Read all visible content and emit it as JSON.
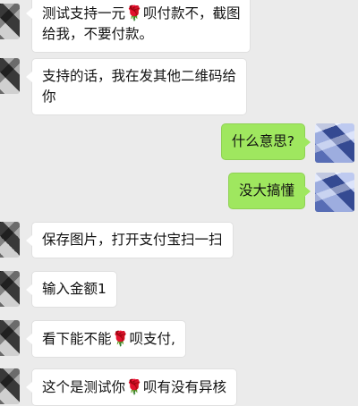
{
  "messages": [
    {
      "side": "left",
      "line1_a": "测试支持一元",
      "line1_b": "呗付款不，截图",
      "line2": "给我，不要付款。",
      "emoji": "rose-icon"
    },
    {
      "side": "left",
      "line1": "支持的话，我在发其他二维码给",
      "line2": "你"
    },
    {
      "side": "right",
      "text": "什么意思?"
    },
    {
      "side": "right",
      "text": "没大搞懂"
    },
    {
      "side": "left",
      "text": "保存图片，打开支付宝扫一扫"
    },
    {
      "side": "left",
      "text": "输入金额1"
    },
    {
      "side": "left",
      "text_a": "看下能不能",
      "text_b": "呗支付,",
      "emoji": "rose-icon"
    },
    {
      "side": "left",
      "text_a": "这个是测试你",
      "text_b": "呗有没有异核",
      "emoji": "rose-icon"
    }
  ],
  "emoji_glyph": "🌹"
}
